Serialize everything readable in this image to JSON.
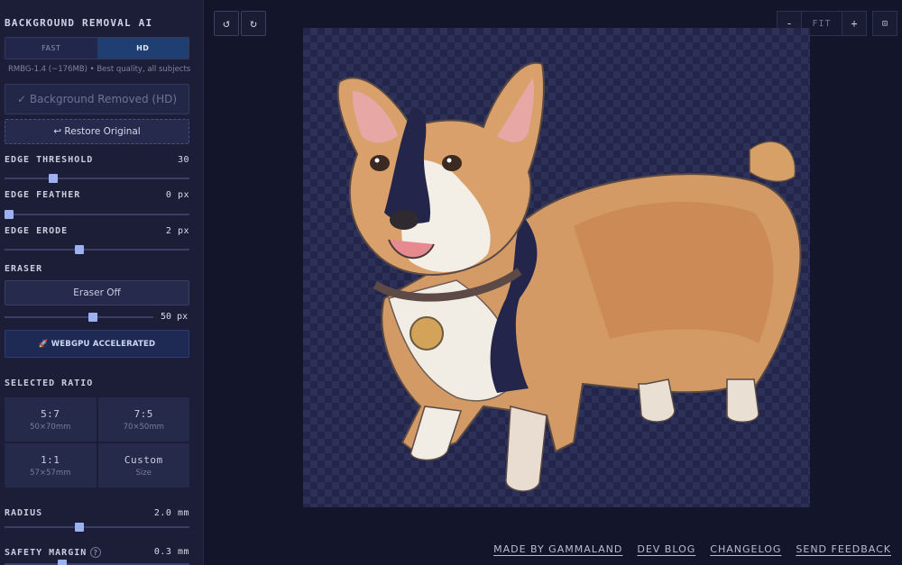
{
  "sidebar": {
    "title": "BACKGROUND REMOVAL AI",
    "mode": {
      "fast_label": "FAST",
      "hd_label": "HD",
      "selected": "HD"
    },
    "model_info": "RMBG-1.4 (~176MB) • Best quality, all subjects",
    "removed_button": "✓ Background Removed (HD)",
    "restore_button": "↩ Restore Original",
    "edge_threshold": {
      "label": "EDGE THRESHOLD",
      "value_text": "30",
      "fraction": 0.25
    },
    "edge_feather": {
      "label": "EDGE FEATHER",
      "value_text": "0 px",
      "fraction": 0.0
    },
    "edge_erode": {
      "label": "EDGE ERODE",
      "value_text": "2 px",
      "fraction": 0.4
    },
    "eraser": {
      "label": "ERASER",
      "button": "Eraser Off",
      "value_text": "50 px",
      "fraction": 0.6
    },
    "webgpu_button": "🚀 WEBGPU ACCELERATED",
    "ratio": {
      "label": "SELECTED RATIO",
      "options": [
        {
          "name": "5:7",
          "size": "50×70mm"
        },
        {
          "name": "7:5",
          "size": "70×50mm"
        },
        {
          "name": "1:1",
          "size": "57×57mm"
        },
        {
          "name": "Custom",
          "size": "Size"
        }
      ]
    },
    "radius": {
      "label": "RADIUS",
      "value_text": "2.0 mm",
      "fraction": 0.4
    },
    "safety_margin": {
      "label": "SAFETY MARGIN",
      "help": "?",
      "value_text": "0.3 mm",
      "fraction": 0.3
    }
  },
  "toolbar": {
    "rotate_left_icon": "↺",
    "rotate_right_icon": "↻",
    "zoom_out": "-",
    "zoom_label": "FIT",
    "zoom_in": "+",
    "fullscreen_icon": "⊡"
  },
  "footer": {
    "links": [
      "MADE BY GAMMALAND",
      "DEV BLOG",
      "CHANGELOG",
      "SEND FEEDBACK"
    ]
  },
  "colors": {
    "accent": "#9db0ef",
    "hd_active": "#1f3e72",
    "background": "#13152a"
  }
}
